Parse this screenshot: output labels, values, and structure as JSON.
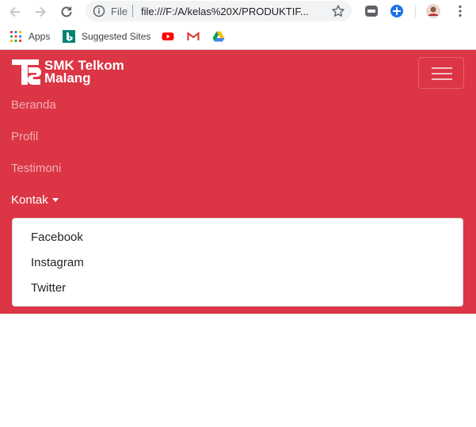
{
  "browser": {
    "scheme": "File",
    "url": "file:///F:/A/kelas%20X/PRODUKTIF...",
    "bookmarks": [
      {
        "label": "Apps",
        "icon": "apps-grid-icon"
      },
      {
        "label": "Suggested Sites",
        "icon": "bing-icon"
      },
      {
        "label": "",
        "icon": "youtube-icon"
      },
      {
        "label": "",
        "icon": "gmail-icon"
      },
      {
        "label": "",
        "icon": "google-drive-icon"
      }
    ]
  },
  "navbar": {
    "brand_line1": "SMK Telkom",
    "brand_line2": "Malang",
    "links": [
      {
        "label": "Beranda",
        "active": false
      },
      {
        "label": "Profil",
        "active": false
      },
      {
        "label": "Testimoni",
        "active": false
      },
      {
        "label": "Kontak",
        "active": true
      }
    ],
    "dropdown_items": [
      "Facebook",
      "Instagram",
      "Twitter"
    ]
  },
  "colors": {
    "navbar_bg": "#dc3545",
    "accent": "#1a73e8"
  }
}
